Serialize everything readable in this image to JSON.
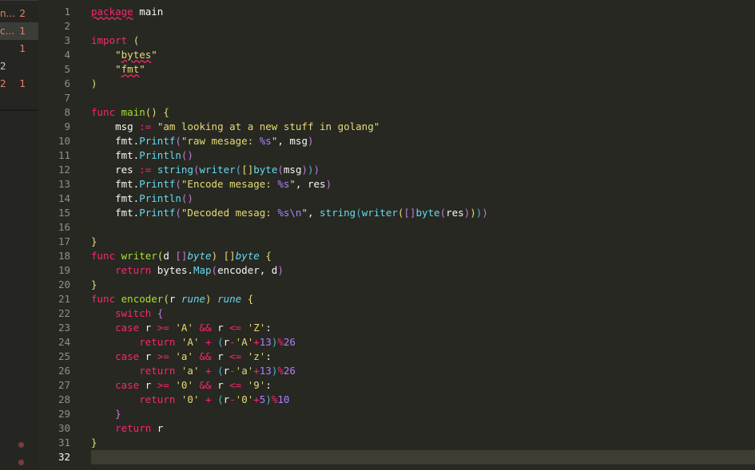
{
  "sidebar": {
    "rows": [
      {
        "name": "n...",
        "count": "2"
      },
      {
        "name": "c...",
        "count": "1"
      },
      {
        "name": "",
        "count": "1"
      },
      {
        "name": "2",
        "count": ""
      },
      {
        "name": "2",
        "count": "1"
      }
    ]
  },
  "editor": {
    "current_line": "32",
    "line_numbers": [
      "1",
      "2",
      "3",
      "4",
      "5",
      "6",
      "7",
      "8",
      "9",
      "10",
      "11",
      "12",
      "13",
      "14",
      "15",
      "16",
      "17",
      "18",
      "19",
      "20",
      "21",
      "22",
      "23",
      "24",
      "25",
      "26",
      "27",
      "28",
      "29",
      "30",
      "31",
      "32"
    ],
    "lines": [
      [
        [
          "package",
          "k ul"
        ],
        [
          " ",
          "w"
        ],
        [
          "main",
          "w"
        ]
      ],
      [],
      [
        [
          "import",
          "k"
        ],
        [
          " ",
          "w"
        ],
        [
          "(",
          "b1"
        ]
      ],
      [
        [
          "    ",
          "w"
        ],
        [
          "\"",
          "s"
        ],
        [
          "bytes",
          "s ul"
        ],
        [
          "\"",
          "s"
        ]
      ],
      [
        [
          "    ",
          "w"
        ],
        [
          "\"",
          "s"
        ],
        [
          "fmt",
          "s ul"
        ],
        [
          "\"",
          "s"
        ]
      ],
      [
        [
          ")",
          "b1"
        ]
      ],
      [],
      [
        [
          "func",
          "k"
        ],
        [
          " ",
          "w"
        ],
        [
          "main",
          "f"
        ],
        [
          "()",
          "b1"
        ],
        [
          " ",
          "w"
        ],
        [
          "{",
          "b1"
        ]
      ],
      [
        [
          "    msg ",
          "w"
        ],
        [
          ":=",
          "o"
        ],
        [
          " ",
          "w"
        ],
        [
          "\"am looking at a new stuff in golang\"",
          "s"
        ]
      ],
      [
        [
          "    fmt.",
          "w"
        ],
        [
          "Printf",
          "c"
        ],
        [
          "(",
          "b2"
        ],
        [
          "\"raw mesage: ",
          "s"
        ],
        [
          "%s",
          "n"
        ],
        [
          "\"",
          "s"
        ],
        [
          ", msg",
          "w"
        ],
        [
          ")",
          "b2"
        ]
      ],
      [
        [
          "    fmt.",
          "w"
        ],
        [
          "Println",
          "c"
        ],
        [
          "()",
          "b2"
        ]
      ],
      [
        [
          "    res ",
          "w"
        ],
        [
          ":=",
          "o"
        ],
        [
          " ",
          "w"
        ],
        [
          "string",
          "c"
        ],
        [
          "(",
          "b2"
        ],
        [
          "writer",
          "c"
        ],
        [
          "(",
          "b3"
        ],
        [
          "[]",
          "b1"
        ],
        [
          "byte",
          "c"
        ],
        [
          "(",
          "b2"
        ],
        [
          "msg",
          "w"
        ],
        [
          ")",
          "b2"
        ],
        [
          ")",
          "b3"
        ],
        [
          ")",
          "b2"
        ]
      ],
      [
        [
          "    fmt.",
          "w"
        ],
        [
          "Printf",
          "c"
        ],
        [
          "(",
          "b2"
        ],
        [
          "\"Encode mesage: ",
          "s"
        ],
        [
          "%s",
          "n"
        ],
        [
          "\"",
          "s"
        ],
        [
          ", res",
          "w"
        ],
        [
          ")",
          "b2"
        ]
      ],
      [
        [
          "    fmt.",
          "w"
        ],
        [
          "Println",
          "c"
        ],
        [
          "()",
          "b2"
        ]
      ],
      [
        [
          "    fmt.",
          "w"
        ],
        [
          "Printf",
          "c"
        ],
        [
          "(",
          "b2"
        ],
        [
          "\"Decoded mesag: ",
          "s"
        ],
        [
          "%s\\n",
          "n"
        ],
        [
          "\"",
          "s"
        ],
        [
          ", ",
          "w"
        ],
        [
          "string",
          "c"
        ],
        [
          "(",
          "b3"
        ],
        [
          "writer",
          "c"
        ],
        [
          "(",
          "b1"
        ],
        [
          "[]",
          "b2"
        ],
        [
          "byte",
          "c"
        ],
        [
          "(",
          "b2"
        ],
        [
          "res",
          "w"
        ],
        [
          ")",
          "b2"
        ],
        [
          ")",
          "b1"
        ],
        [
          ")",
          "b3"
        ],
        [
          ")",
          "b2"
        ]
      ],
      [],
      [
        [
          "}",
          "b1"
        ]
      ],
      [
        [
          "func",
          "k"
        ],
        [
          " ",
          "w"
        ],
        [
          "writer",
          "f"
        ],
        [
          "(",
          "b1"
        ],
        [
          "d ",
          "w"
        ],
        [
          "[]",
          "b2"
        ],
        [
          "byte",
          "t"
        ],
        [
          ")",
          "b1"
        ],
        [
          " ",
          "w"
        ],
        [
          "[]",
          "b1"
        ],
        [
          "byte",
          "t"
        ],
        [
          " ",
          "w"
        ],
        [
          "{",
          "b1"
        ]
      ],
      [
        [
          "    ",
          "w"
        ],
        [
          "return",
          "k"
        ],
        [
          " bytes.",
          "w"
        ],
        [
          "Map",
          "c"
        ],
        [
          "(",
          "b2"
        ],
        [
          "encoder, d",
          "w"
        ],
        [
          ")",
          "b2"
        ]
      ],
      [
        [
          "}",
          "b1"
        ]
      ],
      [
        [
          "func",
          "k"
        ],
        [
          " ",
          "w"
        ],
        [
          "encoder",
          "f"
        ],
        [
          "(",
          "b1"
        ],
        [
          "r ",
          "w"
        ],
        [
          "rune",
          "t"
        ],
        [
          ")",
          "b1"
        ],
        [
          " ",
          "w"
        ],
        [
          "rune",
          "t"
        ],
        [
          " ",
          "w"
        ],
        [
          "{",
          "b1"
        ]
      ],
      [
        [
          "    ",
          "w"
        ],
        [
          "switch",
          "k"
        ],
        [
          " ",
          "w"
        ],
        [
          "{",
          "b2"
        ]
      ],
      [
        [
          "    ",
          "w"
        ],
        [
          "case",
          "k"
        ],
        [
          " r ",
          "w"
        ],
        [
          ">=",
          "o"
        ],
        [
          " ",
          "w"
        ],
        [
          "'A'",
          "s"
        ],
        [
          " ",
          "w"
        ],
        [
          "&&",
          "o"
        ],
        [
          " r ",
          "w"
        ],
        [
          "<=",
          "o"
        ],
        [
          " ",
          "w"
        ],
        [
          "'Z'",
          "s"
        ],
        [
          ":",
          "w"
        ]
      ],
      [
        [
          "        ",
          "w"
        ],
        [
          "return",
          "k"
        ],
        [
          " ",
          "w"
        ],
        [
          "'A'",
          "s"
        ],
        [
          " ",
          "w"
        ],
        [
          "+",
          "o"
        ],
        [
          " ",
          "w"
        ],
        [
          "(",
          "b3"
        ],
        [
          "r",
          "w"
        ],
        [
          "-",
          "o"
        ],
        [
          "'A'",
          "s"
        ],
        [
          "+",
          "o"
        ],
        [
          "13",
          "n"
        ],
        [
          ")",
          "b3"
        ],
        [
          "%",
          "o"
        ],
        [
          "26",
          "n"
        ]
      ],
      [
        [
          "    ",
          "w"
        ],
        [
          "case",
          "k"
        ],
        [
          " r ",
          "w"
        ],
        [
          ">=",
          "o"
        ],
        [
          " ",
          "w"
        ],
        [
          "'a'",
          "s"
        ],
        [
          " ",
          "w"
        ],
        [
          "&&",
          "o"
        ],
        [
          " r ",
          "w"
        ],
        [
          "<=",
          "o"
        ],
        [
          " ",
          "w"
        ],
        [
          "'z'",
          "s"
        ],
        [
          ":",
          "w"
        ]
      ],
      [
        [
          "        ",
          "w"
        ],
        [
          "return",
          "k"
        ],
        [
          " ",
          "w"
        ],
        [
          "'a'",
          "s"
        ],
        [
          " ",
          "w"
        ],
        [
          "+",
          "o"
        ],
        [
          " ",
          "w"
        ],
        [
          "(",
          "b3"
        ],
        [
          "r",
          "w"
        ],
        [
          "-",
          "o"
        ],
        [
          "'a'",
          "s"
        ],
        [
          "+",
          "o"
        ],
        [
          "13",
          "n"
        ],
        [
          ")",
          "b3"
        ],
        [
          "%",
          "o"
        ],
        [
          "26",
          "n"
        ]
      ],
      [
        [
          "    ",
          "w"
        ],
        [
          "case",
          "k"
        ],
        [
          " r ",
          "w"
        ],
        [
          ">=",
          "o"
        ],
        [
          " ",
          "w"
        ],
        [
          "'0'",
          "s"
        ],
        [
          " ",
          "w"
        ],
        [
          "&&",
          "o"
        ],
        [
          " r ",
          "w"
        ],
        [
          "<=",
          "o"
        ],
        [
          " ",
          "w"
        ],
        [
          "'9'",
          "s"
        ],
        [
          ":",
          "w"
        ]
      ],
      [
        [
          "        ",
          "w"
        ],
        [
          "return",
          "k"
        ],
        [
          " ",
          "w"
        ],
        [
          "'0'",
          "s"
        ],
        [
          " ",
          "w"
        ],
        [
          "+",
          "o"
        ],
        [
          " ",
          "w"
        ],
        [
          "(",
          "b3"
        ],
        [
          "r",
          "w"
        ],
        [
          "-",
          "o"
        ],
        [
          "'0'",
          "s"
        ],
        [
          "+",
          "o"
        ],
        [
          "5",
          "n"
        ],
        [
          ")",
          "b3"
        ],
        [
          "%",
          "o"
        ],
        [
          "10",
          "n"
        ]
      ],
      [
        [
          "    ",
          "w"
        ],
        [
          "}",
          "b2"
        ]
      ],
      [
        [
          "    ",
          "w"
        ],
        [
          "return",
          "k"
        ],
        [
          " r",
          "w"
        ]
      ],
      [
        [
          "}",
          "b1"
        ]
      ],
      []
    ]
  },
  "colors": {
    "background": "#272822",
    "keyword": "#f92672",
    "function": "#a6e22e",
    "string": "#e6db74",
    "builtin": "#66d9ef",
    "number": "#ae81ff"
  }
}
